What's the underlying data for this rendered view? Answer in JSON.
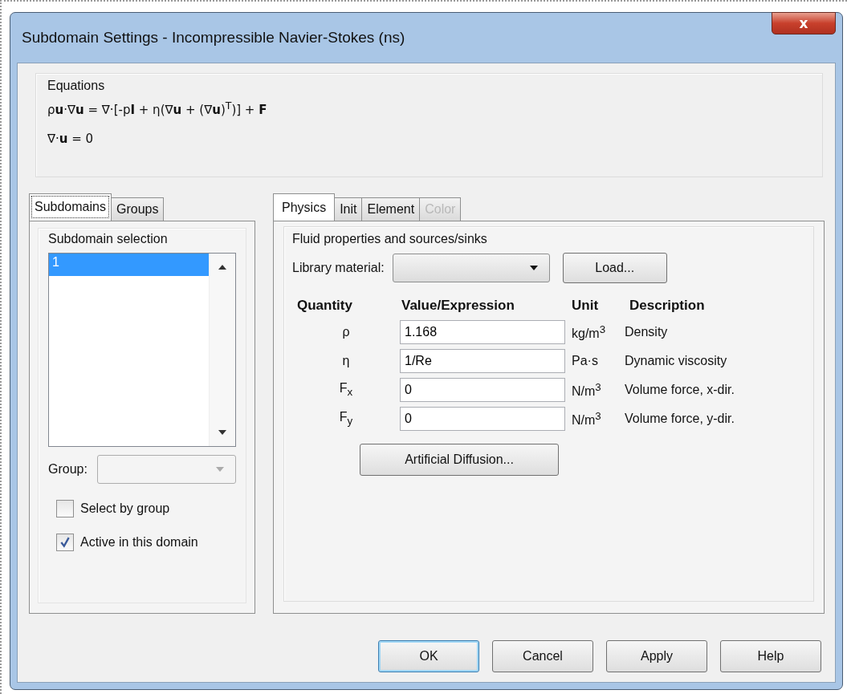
{
  "window": {
    "title": "Subdomain Settings - Incompressible Navier-Stokes (ns)",
    "close": "x"
  },
  "equations": {
    "title": "Equations",
    "lines": [
      "ρ**u**·∇**u** = ∇·[-p**I** + η(∇**u** + (∇**u**)$^{T}$)] + **F**",
      "∇·**u** = 0"
    ]
  },
  "left_tabs": [
    {
      "label": "Subdomains",
      "selected": true
    },
    {
      "label": "Groups",
      "selected": false
    }
  ],
  "subdomain_selection": {
    "title": "Subdomain selection",
    "items": [
      {
        "label": "1",
        "selected": true
      }
    ]
  },
  "group": {
    "label": "Group:"
  },
  "checkboxes": [
    {
      "label": "Select by group",
      "checked": false
    },
    {
      "label": "Active in this domain",
      "checked": true
    }
  ],
  "right_tabs": [
    {
      "label": "Physics",
      "selected": true,
      "disabled": false
    },
    {
      "label": "Init",
      "selected": false,
      "disabled": false
    },
    {
      "label": "Element",
      "selected": false,
      "disabled": false
    },
    {
      "label": "Color",
      "selected": false,
      "disabled": true
    }
  ],
  "fluid": {
    "title": "Fluid properties and sources/sinks",
    "library_label": "Library material:",
    "load_button": "Load...",
    "columns": [
      "Quantity",
      "Value/Expression",
      "Unit",
      "Description"
    ],
    "rows": [
      {
        "quantity": "ρ",
        "value": "1.168",
        "unit": "kg/m$^{3}$",
        "description": "Density"
      },
      {
        "quantity": "η",
        "value": "1/Re",
        "unit": "Pa·s",
        "description": "Dynamic viscosity"
      },
      {
        "quantity": "F$_{x}$",
        "value": "0",
        "unit": "N/m$^{3}$",
        "description": "Volume force, x-dir."
      },
      {
        "quantity": "F$_{y}$",
        "value": "0",
        "unit": "N/m$^{3}$",
        "description": "Volume force, y-dir."
      }
    ],
    "diffusion_button": "Artificial Diffusion..."
  },
  "buttons": [
    {
      "label": "OK",
      "default": true
    },
    {
      "label": "Cancel",
      "default": false
    },
    {
      "label": "Apply",
      "default": false
    },
    {
      "label": "Help",
      "default": false
    }
  ]
}
